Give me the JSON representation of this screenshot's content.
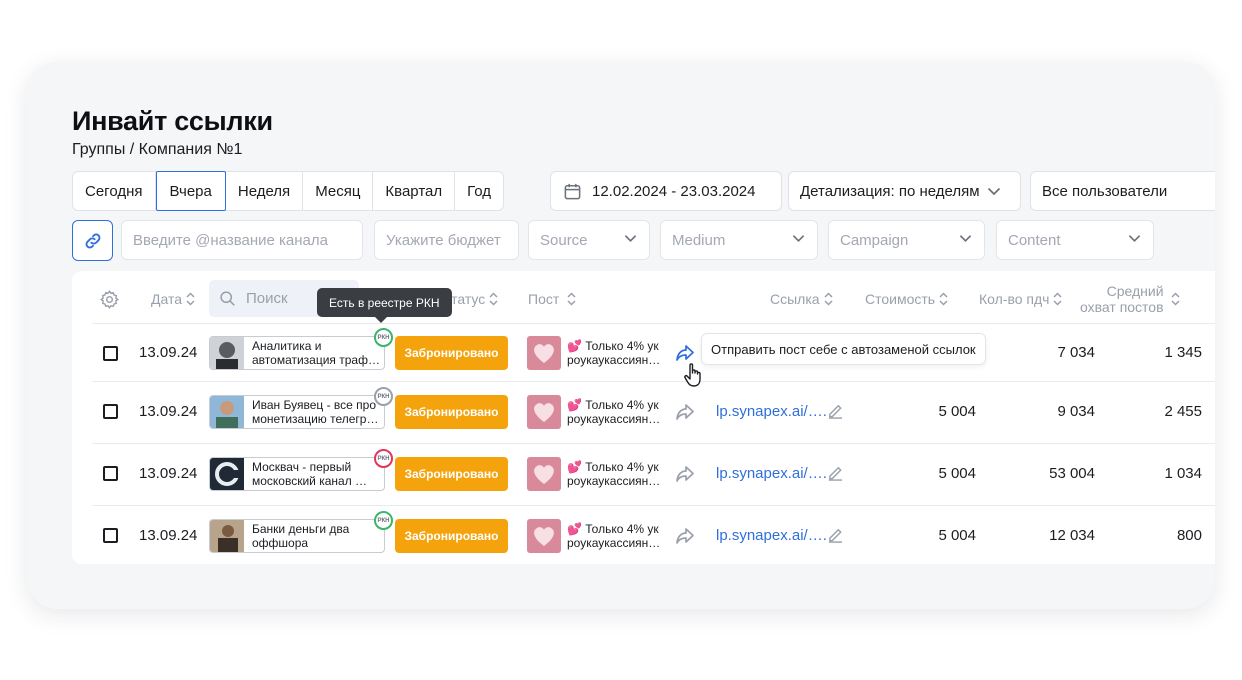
{
  "page": {
    "title": "Инвайт ссылки",
    "breadcrumb": "Группы / Компания №1"
  },
  "periods": [
    "Сегодня",
    "Вчера",
    "Неделя",
    "Месяц",
    "Квартал",
    "Год"
  ],
  "active_period": "Вчера",
  "date_range": "12.02.2024 - 23.03.2024",
  "detail": "Детализация: по неделям",
  "users": "Все пользователи",
  "filters": {
    "channel_placeholder": "Введите @название канала",
    "budget_placeholder": "Укажите бюджет",
    "source": "Source",
    "medium": "Medium",
    "campaign": "Campaign",
    "content": "Content"
  },
  "table": {
    "headers": {
      "date": "Дата",
      "search": "Поиск",
      "status": "Статус",
      "post": "Пост",
      "link": "Ссылка",
      "cost": "Стоимость",
      "subs": "Кол-во пдч",
      "reach_line1": "Средний",
      "reach_line2": "охват постов"
    },
    "rows": [
      {
        "date": "13.09.24",
        "channel": "Аналитика и автоматизация траф…",
        "rkn": "РКН",
        "rkn_color": "#3bb56a",
        "status": "Забронировано",
        "post": "💕 Только 4% ук роукаукассиян…",
        "link": "",
        "cost": "",
        "subs": "7 034",
        "reach": "1 345"
      },
      {
        "date": "13.09.24",
        "channel": "Иван Буявец - все про монетизацию телегр…",
        "rkn": "РКН",
        "rkn_color": "#9aa0ab",
        "status": "Забронировано",
        "post": "💕 Только 4% ук роукаукассиян…",
        "link": "lp.synapex.ai/….",
        "cost": "5 004",
        "subs": "9 034",
        "reach": "2 455"
      },
      {
        "date": "13.09.24",
        "channel": "Москвач - первый московский канал …",
        "rkn": "РКН",
        "rkn_color": "#e2355a",
        "status": "Забронировано",
        "post": "💕 Только 4% ук роукаукассиян…",
        "link": "lp.synapex.ai/….",
        "cost": "5 004",
        "subs": "53 004",
        "reach": "1 034"
      },
      {
        "date": "13.09.24",
        "channel": "Банки деньги два оффшора",
        "rkn": "РКН",
        "rkn_color": "#3bb56a",
        "status": "Забронировано",
        "post": "💕 Только 4% ук роукаукассиян…",
        "link": "lp.synapex.ai/….",
        "cost": "5 004",
        "subs": "12 034",
        "reach": "800"
      }
    ]
  },
  "tooltips": {
    "rkn": "Есть в реестре РКН",
    "share": "Отправить пост себе с автозаменой ссылок"
  },
  "colors": {
    "accent": "#2f6fdc",
    "status_booked": "#f5a30c",
    "rkn_ok": "#3bb56a",
    "rkn_bad": "#e2355a"
  }
}
